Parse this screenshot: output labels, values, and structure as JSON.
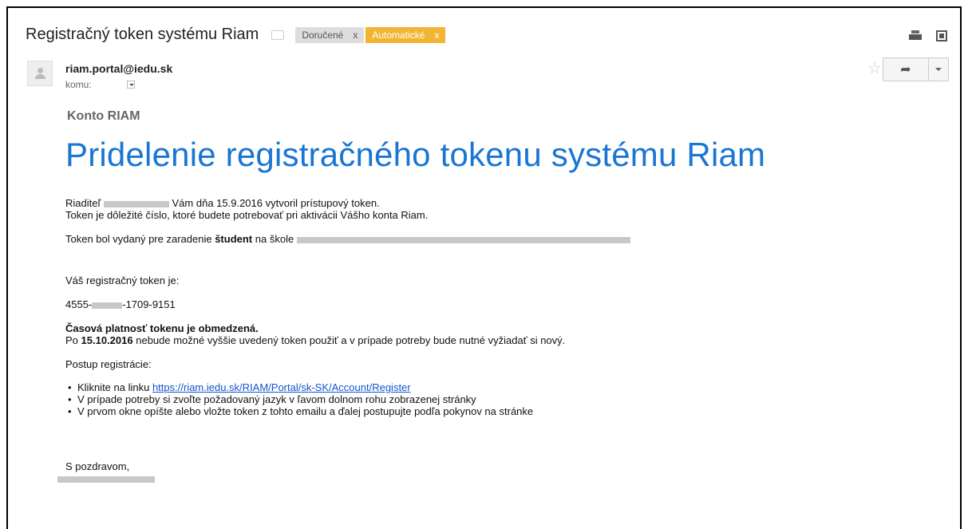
{
  "header": {
    "subject": "Registračný token systému Riam",
    "labels": [
      {
        "name": "Doručené",
        "remove": "x",
        "color": "#dddddd"
      },
      {
        "name": "Automatické",
        "remove": "x",
        "color": "#f1b533"
      }
    ]
  },
  "message": {
    "sender": "riam.portal@iedu.sk",
    "to_label": "komu:"
  },
  "content": {
    "konto": "Konto RIAM",
    "headline": "Pridelenie registračného tokenu systému Riam",
    "p1_prefix": "Riaditeľ",
    "p1_suffix": "Vám dňa 15.9.2016 vytvoril prístupový token.",
    "p2": "Token je dôležité číslo, ktoré budete potrebovať pri aktivácii Vášho konta Riam.",
    "p3_prefix": "Token bol vydaný pre zaradenie",
    "p3_bold": "študent",
    "p3_mid": "na škole",
    "token_intro": "Váš registračný token je:",
    "token_prefix": "4555-",
    "token_suffix": "-1709-9151",
    "validity_title": "Časová platnosť tokenu je obmedzená.",
    "validity_prefix": "Po",
    "validity_date": "15.10.2016",
    "validity_suffix": "nebude možné vyššie uvedený token použiť a v prípade potreby bude nutné vyžiadať si nový.",
    "steps_title": "Postup registrácie:",
    "step1_prefix": "Kliknite na linku",
    "step1_link": "https://riam.iedu.sk/RIAM/Portal/sk-SK/Account/Register",
    "step2": "V prípade potreby si zvoľte požadovaný jazyk v ľavom dolnom rohu zobrazenej stránky",
    "step3": "V prvom okne opíšte alebo vložte token z tohto emailu a ďalej postupujte podľa pokynov na stránke",
    "closing": "S pozdravom,"
  },
  "colors": {
    "headline": "#1976d2",
    "link": "#1155cc",
    "label_automatic": "#f1b533"
  },
  "icons": [
    "print-icon",
    "new-window-icon",
    "star-icon",
    "reply-icon",
    "more-options-icon",
    "avatar-icon"
  ]
}
